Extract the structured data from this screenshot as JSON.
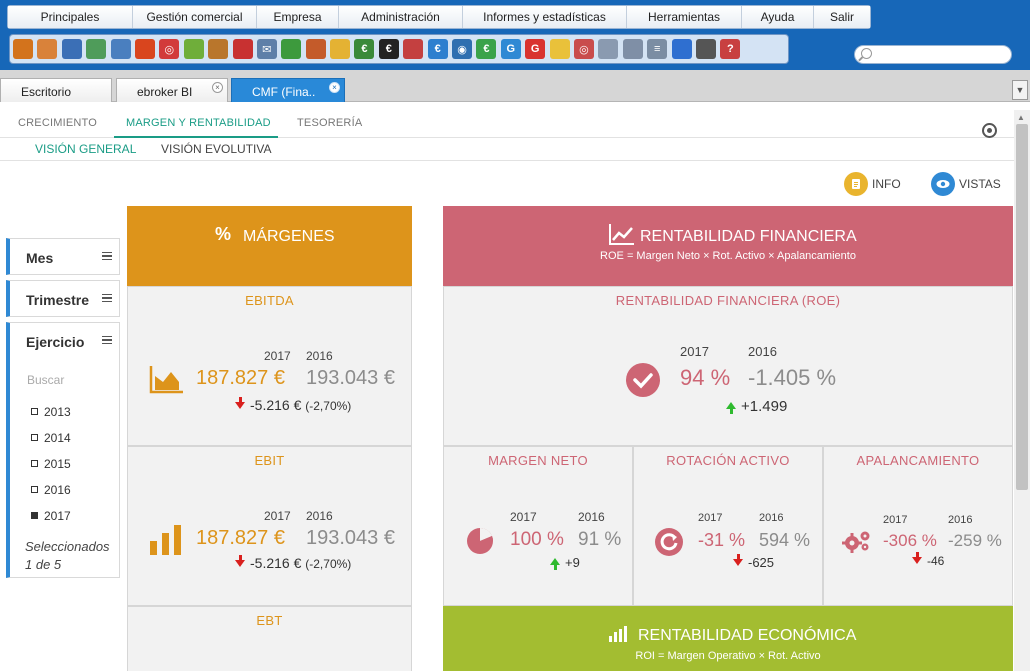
{
  "menu": [
    "Principales",
    "Gestión comercial",
    "Empresa",
    "Administración",
    "Informes y estadísticas",
    "Herramientas",
    "Ayuda",
    "Salir"
  ],
  "toolbar_icons": [
    {
      "name": "cubes-icon",
      "color": "#d3731c",
      "glyph": ""
    },
    {
      "name": "user-icon",
      "color": "#d9823a",
      "glyph": ""
    },
    {
      "name": "contacts-icon",
      "color": "#3b6fb6",
      "glyph": ""
    },
    {
      "name": "card-icon",
      "color": "#4f9c5a",
      "glyph": ""
    },
    {
      "name": "window-icon",
      "color": "#4a7fbf",
      "glyph": ""
    },
    {
      "name": "flame-icon",
      "color": "#d9451e",
      "glyph": ""
    },
    {
      "name": "target-icon",
      "color": "#d23b3b",
      "glyph": "◎"
    },
    {
      "name": "money-icon",
      "color": "#6fae3a",
      "glyph": ""
    },
    {
      "name": "briefcase-icon",
      "color": "#b9762c",
      "glyph": ""
    },
    {
      "name": "camera-icon",
      "color": "#c83131",
      "glyph": ""
    },
    {
      "name": "mail-icon",
      "color": "#5e7fa8",
      "glyph": "✉"
    },
    {
      "name": "building-icon",
      "color": "#3d9a3d",
      "glyph": ""
    },
    {
      "name": "person-icon",
      "color": "#c45b2a",
      "glyph": ""
    },
    {
      "name": "lightbulb-person-icon",
      "color": "#e4b233",
      "glyph": ""
    },
    {
      "name": "euro-flag-icon",
      "color": "#3a8a3a",
      "glyph": "€"
    },
    {
      "name": "euro-coin-icon",
      "color": "#222222",
      "glyph": "€"
    },
    {
      "name": "group-icon",
      "color": "#c44040",
      "glyph": ""
    },
    {
      "name": "euro-circle-icon",
      "color": "#2d7fcf",
      "glyph": "€"
    },
    {
      "name": "eye-euro-icon",
      "color": "#2f6fb0",
      "glyph": "◉"
    },
    {
      "name": "euro-green-icon",
      "color": "#3aa34a",
      "glyph": "€"
    },
    {
      "name": "refresh-g-icon",
      "color": "#2f89d4",
      "glyph": "G"
    },
    {
      "name": "google-icon",
      "color": "#d9332f",
      "glyph": "G"
    },
    {
      "name": "bulb-icon",
      "color": "#e9c13a",
      "glyph": ""
    },
    {
      "name": "target-doc-icon",
      "color": "#c94c4c",
      "glyph": "◎"
    },
    {
      "name": "documents-icon",
      "color": "#8a9ab0",
      "glyph": ""
    },
    {
      "name": "report-icon",
      "color": "#7f8fa6",
      "glyph": ""
    },
    {
      "name": "list-icon",
      "color": "#7b8da3",
      "glyph": "≡"
    },
    {
      "name": "phone-icon",
      "color": "#2f6fd0",
      "glyph": ""
    },
    {
      "name": "tools-icon",
      "color": "#555555",
      "glyph": ""
    },
    {
      "name": "help-icon",
      "color": "#c84040",
      "glyph": "?"
    }
  ],
  "tabs": [
    {
      "label": "Escritorio",
      "active": false,
      "closable": false
    },
    {
      "label": "ebroker BI",
      "active": false,
      "closable": true
    },
    {
      "label": "CMF (Fina..",
      "active": true,
      "closable": true
    }
  ],
  "nav_primary": [
    "CRECIMIENTO",
    "MARGEN Y RENTABILIDAD",
    "TESORERÍA"
  ],
  "nav_secondary": [
    "VISIÓN GENERAL",
    "VISIÓN EVOLUTIVA"
  ],
  "buttons": {
    "info": "INFO",
    "vistas": "VISTAS"
  },
  "filters": {
    "month": "Mes",
    "quarter": "Trimestre",
    "year": "Ejercicio",
    "search_placeholder": "Buscar",
    "years": [
      {
        "label": "2013",
        "checked": false
      },
      {
        "label": "2014",
        "checked": false
      },
      {
        "label": "2015",
        "checked": false
      },
      {
        "label": "2016",
        "checked": false
      },
      {
        "label": "2017",
        "checked": true
      }
    ],
    "selected_summary": "Seleccionados 1 de 5"
  },
  "margins": {
    "header_icon": "%",
    "header": "MÁRGENES",
    "color": "#dd941b",
    "ebitda": {
      "title": "EBITDA",
      "year_current": "2017",
      "year_previous": "2016",
      "value_current": "187.827 €",
      "value_previous": "193.043 €",
      "diff": "-5.216 €",
      "diff_pct": "(-2,70%)"
    },
    "ebit": {
      "title": "EBIT",
      "year_current": "2017",
      "year_previous": "2016",
      "value_current": "187.827 €",
      "value_previous": "193.043 €",
      "diff": "-5.216 €",
      "diff_pct": "(-2,70%)"
    },
    "ebt": {
      "title": "EBT"
    }
  },
  "financial": {
    "header": "RENTABILIDAD FINANCIERA",
    "formula": "ROE = Margen Neto × Rot. Activo × Apalancamiento",
    "color": "#cd6574",
    "roe": {
      "title": "RENTABILIDAD FINANCIERA (ROE)",
      "year_current": "2017",
      "year_previous": "2016",
      "value_current": "94 %",
      "value_previous": "-1.405 %",
      "diff": "+1.499"
    },
    "net_margin": {
      "title": "MARGEN NETO",
      "year_current": "2017",
      "year_previous": "2016",
      "value_current": "100 %",
      "value_previous": "91 %",
      "diff": "+9"
    },
    "asset_turnover": {
      "title": "ROTACIÓN ACTIVO",
      "year_current": "2017",
      "year_previous": "2016",
      "value_current": "-31 %",
      "value_previous": "594 %",
      "diff": "-625"
    },
    "leverage": {
      "title": "APALANCAMIENTO",
      "year_current": "2017",
      "year_previous": "2016",
      "value_current": "-306 %",
      "value_previous": "-259 %",
      "diff": "-46"
    }
  },
  "economic": {
    "header": "RENTABILIDAD ECONÓMICA",
    "formula": "ROI = Margen Operativo × Rot. Activo",
    "color": "#a3bd31"
  }
}
